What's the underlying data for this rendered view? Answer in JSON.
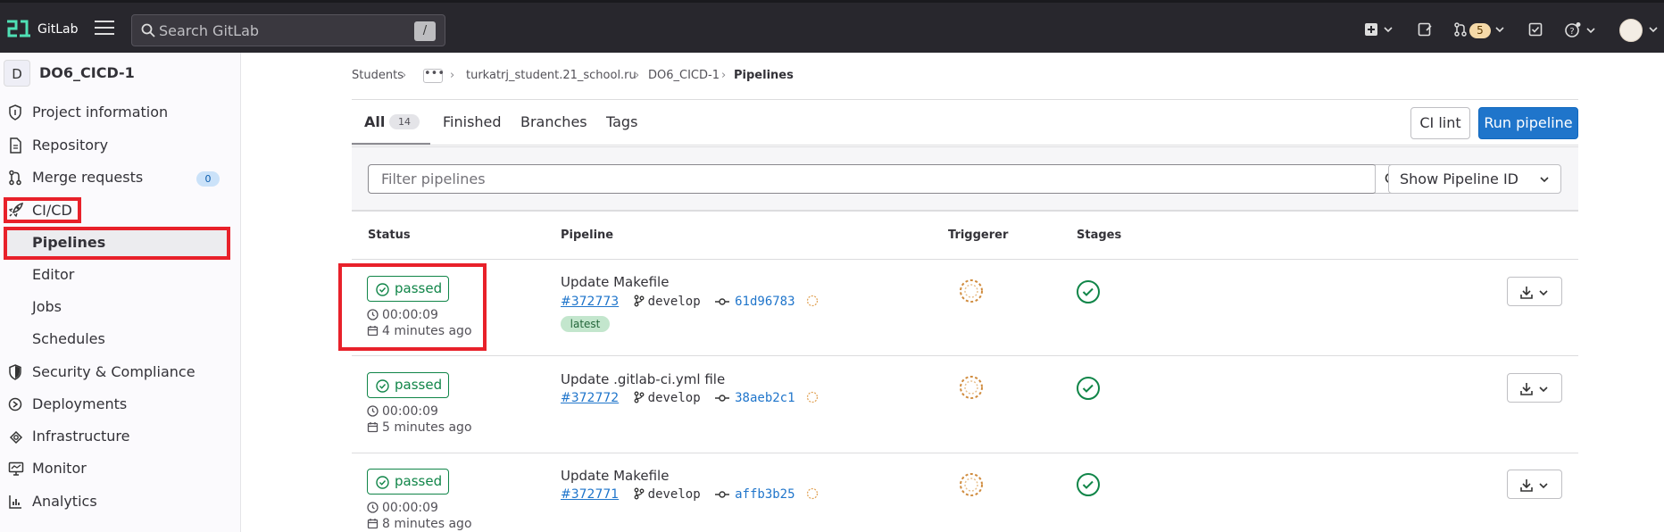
{
  "header": {
    "brand": "GitLab",
    "search_placeholder": "Search GitLab",
    "search_shortcut": "/",
    "merge_requests_count": "5"
  },
  "sidebar": {
    "project_initial": "D",
    "project_name": "DO6_CICD-1",
    "items": [
      {
        "label": "Project information",
        "icon": "info-icon"
      },
      {
        "label": "Repository",
        "icon": "doc-icon"
      },
      {
        "label": "Merge requests",
        "icon": "merge-icon",
        "count": "0"
      },
      {
        "label": "CI/CD",
        "icon": "rocket-icon"
      },
      {
        "label": "Pipelines"
      },
      {
        "label": "Editor"
      },
      {
        "label": "Jobs"
      },
      {
        "label": "Schedules"
      },
      {
        "label": "Security & Compliance",
        "icon": "shield-icon"
      },
      {
        "label": "Deployments",
        "icon": "deploy-icon"
      },
      {
        "label": "Infrastructure",
        "icon": "cloud-icon"
      },
      {
        "label": "Monitor",
        "icon": "monitor-icon"
      },
      {
        "label": "Analytics",
        "icon": "chart-icon"
      }
    ]
  },
  "breadcrumb": {
    "items": [
      "Students",
      "turkatrj_student.21_school.ru",
      "DO6_CICD-1",
      "Pipelines"
    ],
    "ellipsis": "•••"
  },
  "tabs": [
    {
      "label": "All",
      "count": "14"
    },
    {
      "label": "Finished"
    },
    {
      "label": "Branches"
    },
    {
      "label": "Tags"
    }
  ],
  "actions": {
    "ci_lint": "CI lint",
    "run_pipeline": "Run pipeline"
  },
  "filter": {
    "placeholder": "Filter pipelines",
    "show_id": "Show Pipeline ID"
  },
  "table": {
    "headers": [
      "Status",
      "Pipeline",
      "Triggerer",
      "Stages"
    ],
    "rows": [
      {
        "status": "passed",
        "duration": "00:00:09",
        "finished": "4 minutes ago",
        "title": "Update Makefile",
        "id": "#372773",
        "branch": "develop",
        "sha": "61d96783",
        "tag": "latest"
      },
      {
        "status": "passed",
        "duration": "00:00:09",
        "finished": "5 minutes ago",
        "title": "Update .gitlab-ci.yml file",
        "id": "#372772",
        "branch": "develop",
        "sha": "38aeb2c1"
      },
      {
        "status": "passed",
        "duration": "00:00:09",
        "finished": "8 minutes ago",
        "title": "Update Makefile",
        "id": "#372771",
        "branch": "develop",
        "sha": "affb3b25"
      }
    ]
  },
  "colors": {
    "highlight": "#e8212a",
    "success": "#108548",
    "primary": "#1f75cb"
  }
}
